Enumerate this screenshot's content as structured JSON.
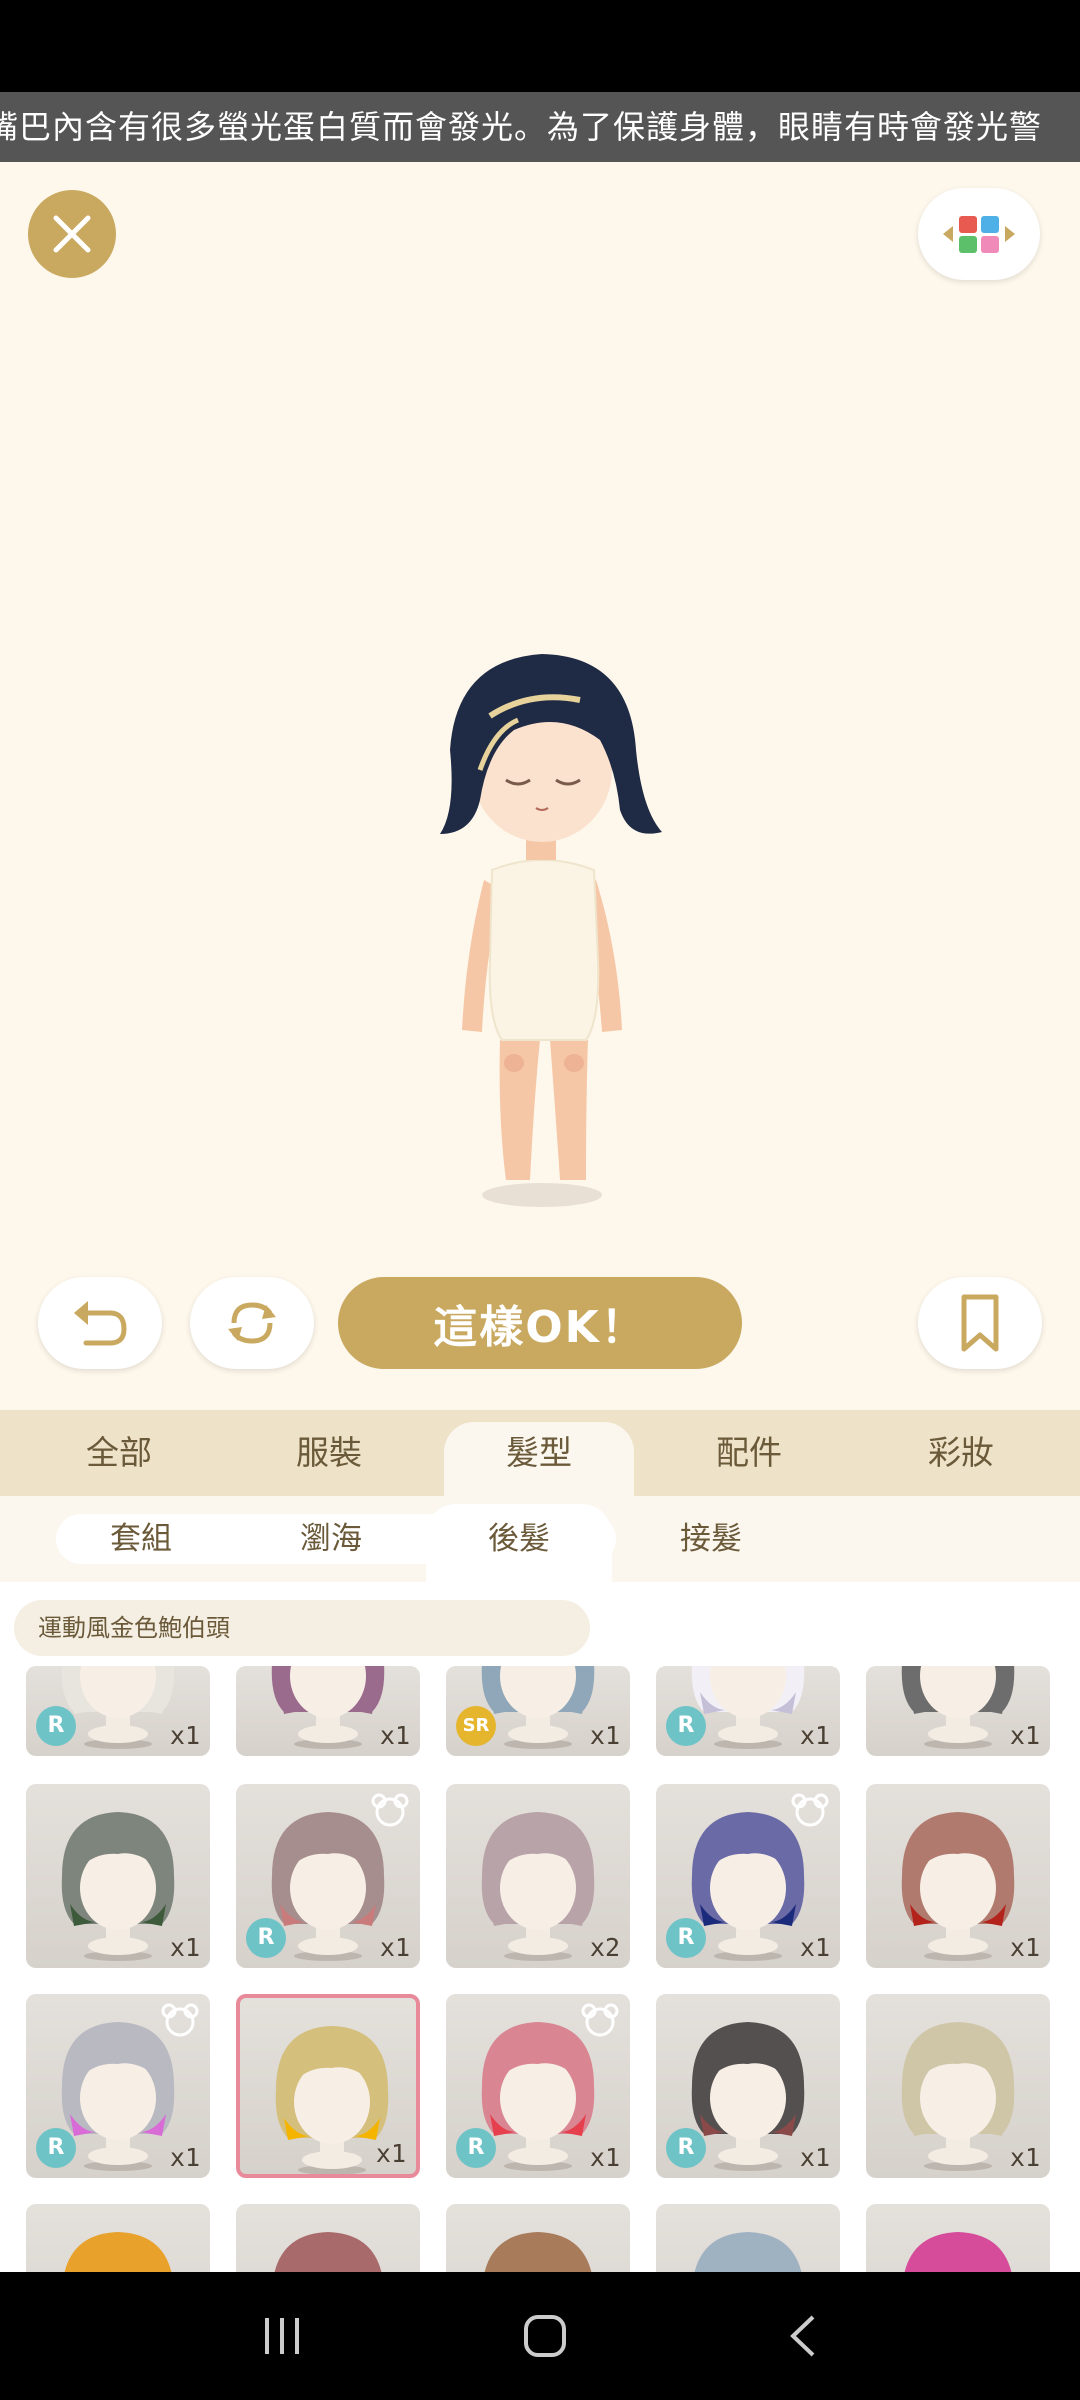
{
  "ticker": {
    "text": "嘴巴內含有很多螢光蛋白質而會發光。為了保護身體，眼睛有時會發光警"
  },
  "actions": {
    "ok_label": "這樣OK！"
  },
  "category_tabs": [
    {
      "label": "全部",
      "active": false
    },
    {
      "label": "服裝",
      "active": false
    },
    {
      "label": "髮型",
      "active": true
    },
    {
      "label": "配件",
      "active": false
    },
    {
      "label": "彩妝",
      "active": false
    }
  ],
  "sub_tabs": [
    {
      "label": "套組",
      "active": false
    },
    {
      "label": "瀏海",
      "active": false
    },
    {
      "label": "後髮",
      "active": true
    },
    {
      "label": "接髮",
      "active": false
    }
  ],
  "selected_item_name": "運動風金色鮑伯頭",
  "items": [
    {
      "qty": "x1",
      "rarity": "R",
      "bear": false,
      "hair": "#e8e4de",
      "accent": "#e8e4de",
      "row": 0
    },
    {
      "qty": "x1",
      "rarity": "",
      "bear": false,
      "hair": "#9a6b8d",
      "accent": "#9a6b8d",
      "row": 0
    },
    {
      "qty": "x1",
      "rarity": "SR",
      "bear": false,
      "hair": "#8fa7b8",
      "accent": "#8fa7b8",
      "row": 0
    },
    {
      "qty": "x1",
      "rarity": "R",
      "bear": false,
      "hair": "#f2f0f6",
      "accent": "#c6bfd8",
      "row": 0
    },
    {
      "qty": "x1",
      "rarity": "",
      "bear": false,
      "hair": "#6d6d6d",
      "accent": "#6d6d6d",
      "row": 0
    },
    {
      "qty": "x1",
      "rarity": "",
      "bear": false,
      "hair": "#7e857c",
      "accent": "#3d5a3a",
      "row": 1
    },
    {
      "qty": "x1",
      "rarity": "R",
      "bear": true,
      "hair": "#a78e8e",
      "accent": "#c97b7b",
      "row": 1
    },
    {
      "qty": "x2",
      "rarity": "",
      "bear": false,
      "hair": "#b8a3a8",
      "accent": "#b8a3a8",
      "row": 1
    },
    {
      "qty": "x1",
      "rarity": "R",
      "bear": true,
      "hair": "#6a6aa6",
      "accent": "#1b2a7a",
      "row": 1
    },
    {
      "qty": "x1",
      "rarity": "",
      "bear": false,
      "hair": "#b07a6e",
      "accent": "#b3231c",
      "row": 1
    },
    {
      "qty": "x1",
      "rarity": "R",
      "bear": true,
      "hair": "#b9b9c2",
      "accent": "#d86bd6",
      "row": 2
    },
    {
      "qty": "x1",
      "rarity": "",
      "bear": false,
      "hair": "#d4bf7c",
      "accent": "#f5b400",
      "row": 2,
      "selected": true
    },
    {
      "qty": "x1",
      "rarity": "R",
      "bear": true,
      "hair": "#d98592",
      "accent": "#e6404e",
      "row": 2
    },
    {
      "qty": "x1",
      "rarity": "R",
      "bear": false,
      "hair": "#555050",
      "accent": "#8a4a4a",
      "row": 2
    },
    {
      "qty": "x1",
      "rarity": "",
      "bear": false,
      "hair": "#cfc6a8",
      "accent": "#cfc6a8",
      "row": 2
    },
    {
      "qty": "",
      "rarity": "",
      "bear": false,
      "hair": "#e8a12a",
      "accent": "#e8a12a",
      "row": 3
    },
    {
      "qty": "",
      "rarity": "",
      "bear": false,
      "hair": "#a86a6a",
      "accent": "#a86a6a",
      "row": 3
    },
    {
      "qty": "",
      "rarity": "",
      "bear": false,
      "hair": "#a87c5a",
      "accent": "#a87c5a",
      "row": 3
    },
    {
      "qty": "",
      "rarity": "",
      "bear": false,
      "hair": "#9fb2c2",
      "accent": "#9fb2c2",
      "row": 3
    },
    {
      "qty": "",
      "rarity": "",
      "bear": false,
      "hair": "#d64b9a",
      "accent": "#6bbf4a",
      "row": 3
    }
  ],
  "colors": {
    "gold": "#c9a860",
    "tab_bg": "#eee2c8",
    "selected_border": "#e88a9a",
    "rarity_r": "#6ec3c7",
    "rarity_sr": "#e5b52e"
  }
}
